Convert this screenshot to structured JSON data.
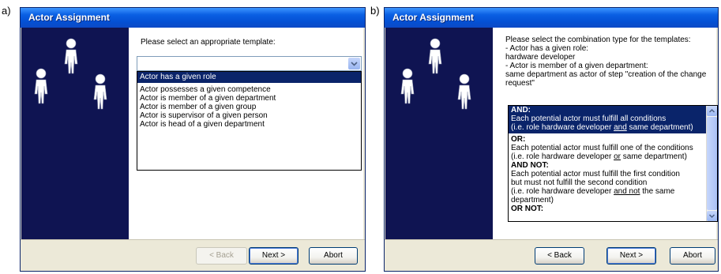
{
  "panels": {
    "a": {
      "label": "a)",
      "title": "Actor Assignment",
      "prompt": "Please select an appropriate template:",
      "combo_value": "",
      "templates": [
        "Actor has a given role",
        "Actor possesses a given competence",
        "Actor is member of a given department",
        "Actor is member of a given group",
        "Actor is supervisor of a given person",
        "Actor is head of a given department"
      ],
      "selected_index": 0,
      "buttons": {
        "back": "< Back",
        "next": "Next >",
        "abort": "Abort"
      }
    },
    "b": {
      "label": "b)",
      "title": "Actor Assignment",
      "prompt": "Please select the combination type for the templates:\n- Actor has a given role:\n hardware developer\n- Actor is member of a given department:\n same department as actor of step \"creation of the change\n request\"",
      "options": [
        {
          "heading": "AND:",
          "line1": "Each potential actor must fulfill all conditions",
          "line2_pre": "(i.e. role hardware developer ",
          "line2_u": "and",
          "line2_post": " same department)"
        },
        {
          "heading": "OR:",
          "line1": "Each potential actor must fulfill one of the conditions",
          "line2_pre": "(i.e. role hardware developer ",
          "line2_u": "or",
          "line2_post": " same department)"
        },
        {
          "heading": "AND NOT:",
          "line1": "Each potential actor must fulfill the first condition",
          "line1b": "but must not fulfill the second condition",
          "line2_pre": "(i.e. role hardware developer ",
          "line2_u": "and not",
          "line2_post": " the same",
          "line3": "department)"
        },
        {
          "heading": "OR NOT:"
        }
      ],
      "selected_index": 0,
      "buttons": {
        "back": "< Back",
        "next": "Next >",
        "abort": "Abort"
      }
    }
  },
  "colors": {
    "side_panel": "#0f1452",
    "selection": "#0a246a",
    "title_blue": "#0450d4"
  },
  "icons": [
    "person-figure-icon",
    "chevron-down-icon",
    "scroll-up-icon",
    "scroll-down-icon"
  ]
}
